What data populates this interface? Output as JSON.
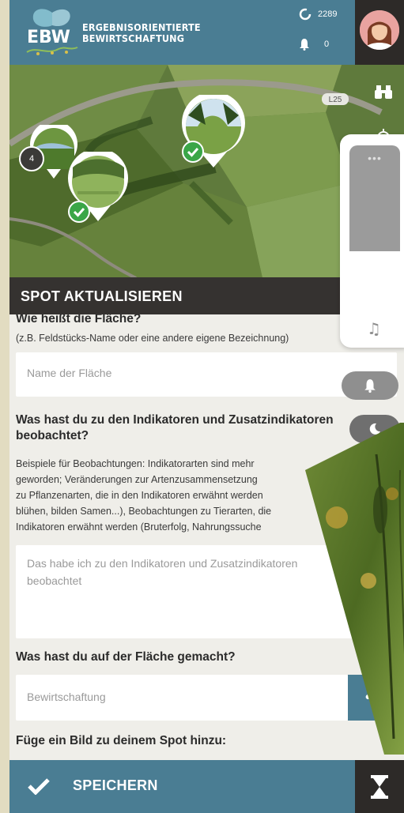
{
  "header": {
    "brand_line1": "ERGEBNISORIENTIERTE",
    "brand_line2": "BEWIRTSCHAFTUNG",
    "logo_text": "EBW",
    "points": "2289",
    "notifications": "0"
  },
  "map": {
    "cluster_count": "4",
    "road_label": "L25"
  },
  "section": {
    "title": "SPOT AKTUALISIEREN"
  },
  "form": {
    "q1_label": "Wie heißt die Fläche?",
    "q1_hint": "(z.B. Feldstücks-Name oder eine andere eigene Bezeichnung)",
    "q1_placeholder": "Name der Fläche",
    "q2_label_line1": "Was hast du zu den Indikatoren und Zusatzindikatoren",
    "q2_label_line2": "beobachtet?",
    "q2_hint_lines": [
      "Beispiele für Beobachtungen: Indikatorarten sind mehr",
      "geworden; Veränderungen zur Artenzusammensetzung",
      "zu Pflanzenarten, die in den Indikatoren erwähnt werden",
      "blühen, bilden Samen...), Beobachtungen zu Tierarten, die",
      "Indikatoren erwähnt werden (Bruterfolg, Nahrungssuche"
    ],
    "q2_placeholder_line1": "Das habe ich zu den Indikatoren und Zusatzindikatoren",
    "q2_placeholder_line2": "beobachtet",
    "q3_label": "Was hast du auf der Fläche gemacht?",
    "q3_placeholder": "Bewirtschaftung",
    "q3_more": "•••",
    "q4_label": "Füge ein Bild zu deinem Spot hinzu:"
  },
  "save": {
    "label": "SPEICHERN"
  },
  "panel": {
    "volume_level": 0.64
  },
  "colors": {
    "accent": "#4a7d93",
    "dark": "#2d2a28",
    "check": "#3aa647"
  }
}
